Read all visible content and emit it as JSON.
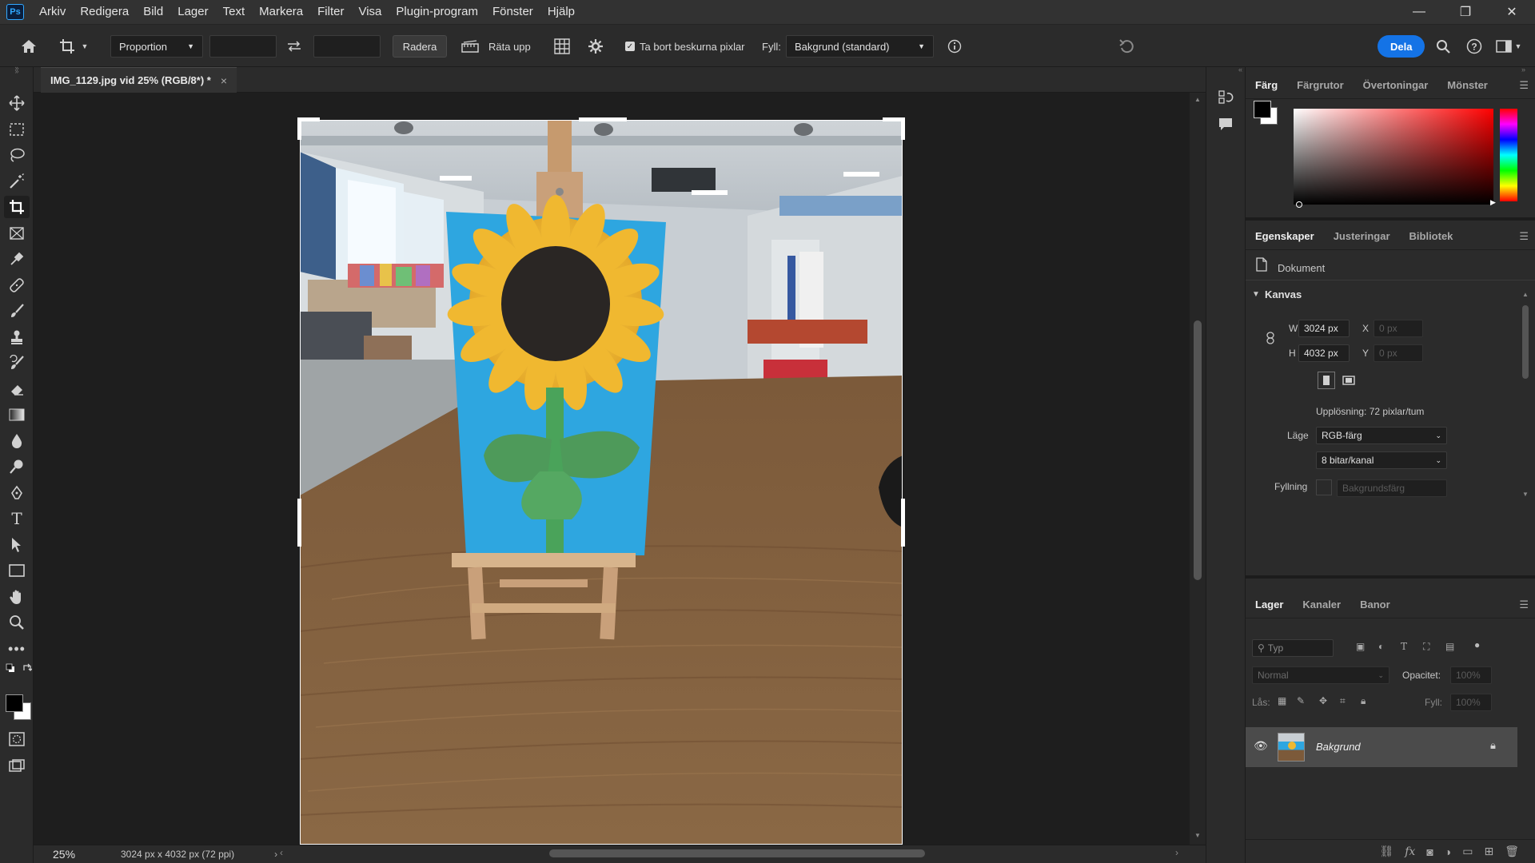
{
  "app": {
    "logo": "Ps"
  },
  "menu": [
    "Arkiv",
    "Redigera",
    "Bild",
    "Lager",
    "Text",
    "Markera",
    "Filter",
    "Visa",
    "Plugin-program",
    "Fönster",
    "Hjälp"
  ],
  "window_controls": {
    "minimize": "—",
    "restore": "❐",
    "close": "✕"
  },
  "options": {
    "ratio_label": "Proportion",
    "width_value": "",
    "height_value": "",
    "clear_label": "Radera",
    "straighten_label": "Räta upp",
    "delete_cropped_label": "Ta bort beskurna pixlar",
    "fill_label": "Fyll:",
    "fill_value": "Bakgrund (standard)",
    "share_label": "Dela"
  },
  "document": {
    "tab_title": "IMG_1129.jpg vid 25% (RGB/8*) *",
    "close": "×"
  },
  "status": {
    "zoom": "25%",
    "info": "3024 px x 4032 px (72 ppi)",
    "arrow": "›"
  },
  "color_panel": {
    "tabs": [
      "Färg",
      "Färgrutor",
      "Övertoningar",
      "Mönster"
    ],
    "active": "Färg",
    "foreground": "#000000",
    "background": "#ffffff",
    "hue": "#ff0000"
  },
  "properties_panel": {
    "tabs": [
      "Egenskaper",
      "Justeringar",
      "Bibliotek"
    ],
    "active": "Egenskaper",
    "doc_label": "Dokument",
    "section": "Kanvas",
    "w_label": "W",
    "w_value": "3024 px",
    "h_label": "H",
    "h_value": "4032 px",
    "x_label": "X",
    "x_value": "0 px",
    "y_label": "Y",
    "y_value": "0 px",
    "resolution": "Upplösning: 72 pixlar/tum",
    "mode_label": "Läge",
    "mode_value": "RGB-färg",
    "depth_value": "8 bitar/kanal",
    "fill_label": "Fyllning",
    "fill_value": "Bakgrundsfärg"
  },
  "layers_panel": {
    "tabs": [
      "Lager",
      "Kanaler",
      "Banor"
    ],
    "active": "Lager",
    "filter_placeholder": "Typ",
    "blend_mode": "Normal",
    "opacity_label": "Opacitet:",
    "opacity_value": "100%",
    "lock_label": "Lås:",
    "fill_label": "Fyll:",
    "fill_value": "100%",
    "layers": [
      {
        "name": "Bakgrund",
        "visible": true,
        "locked": true
      }
    ]
  }
}
